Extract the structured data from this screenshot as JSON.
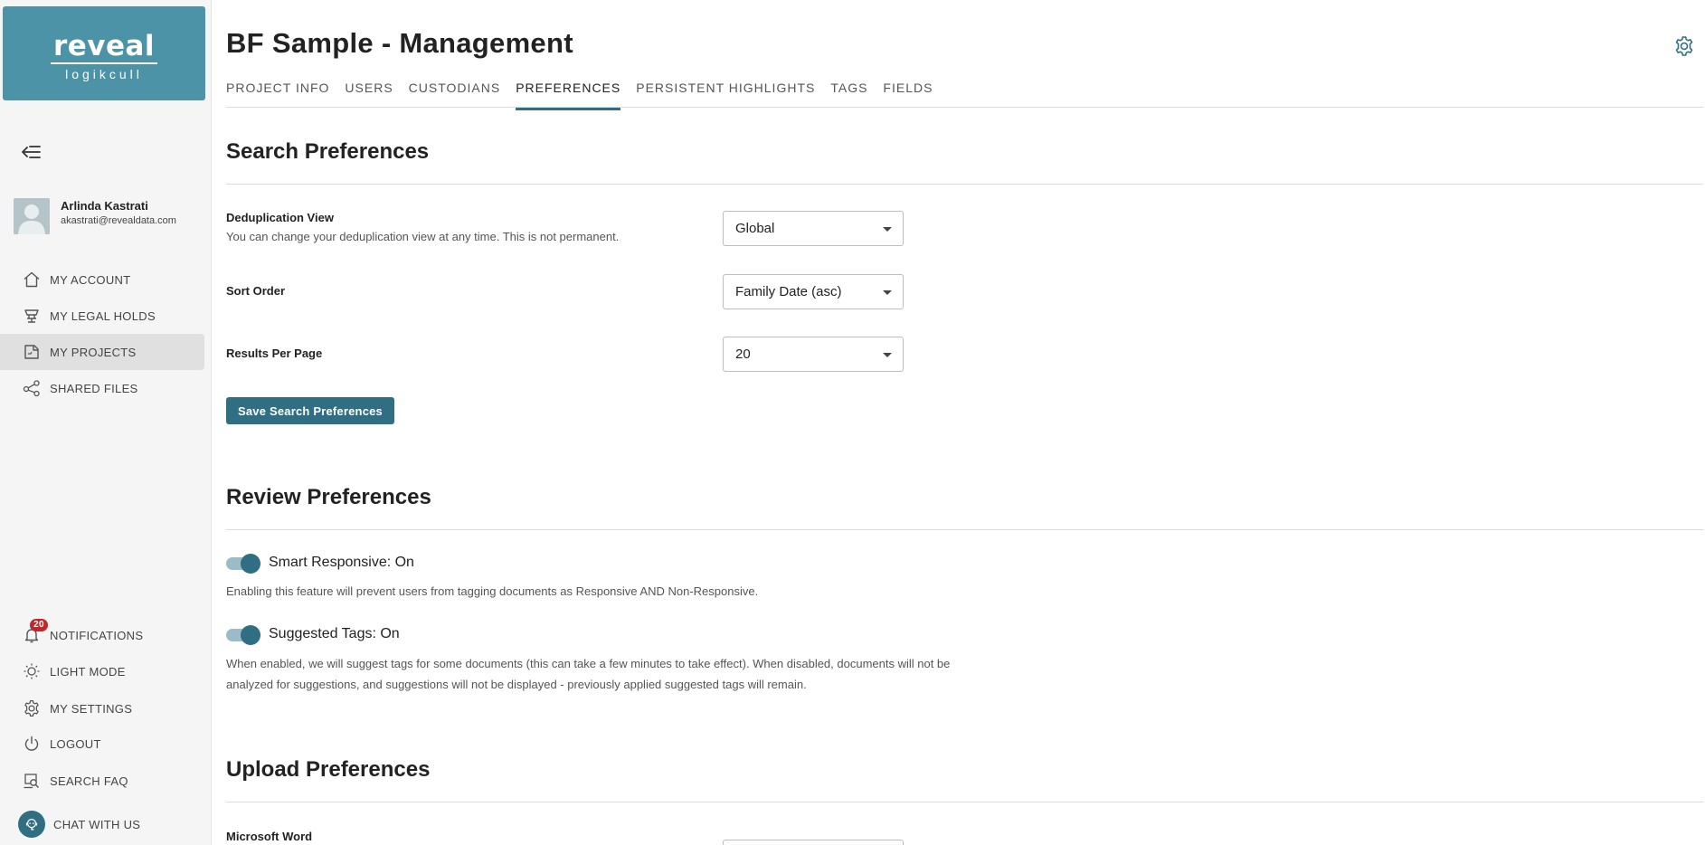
{
  "app": {
    "logo_brand": "reveal",
    "logo_sub": "logikcull"
  },
  "user": {
    "name": "Arlinda Kastrati",
    "email": "akastrati@revealdata.com"
  },
  "sidebar": {
    "items": [
      {
        "label": "MY ACCOUNT",
        "icon": "home-icon"
      },
      {
        "label": "MY LEGAL HOLDS",
        "icon": "legal-hold-icon"
      },
      {
        "label": "MY PROJECTS",
        "icon": "projects-icon",
        "active": true
      },
      {
        "label": "SHARED FILES",
        "icon": "share-icon"
      }
    ],
    "bottom_items": [
      {
        "label": "NOTIFICATIONS",
        "icon": "bell-icon",
        "badge": "20"
      },
      {
        "label": "LIGHT MODE",
        "icon": "sun-icon"
      },
      {
        "label": "MY SETTINGS",
        "icon": "gear-icon"
      },
      {
        "label": "LOGOUT",
        "icon": "power-icon"
      },
      {
        "label": "SEARCH FAQ",
        "icon": "faq-icon"
      },
      {
        "label": "CHAT WITH US",
        "icon": "chat-icon"
      }
    ]
  },
  "header": {
    "title": "BF Sample - Management"
  },
  "tabs": [
    {
      "label": "PROJECT INFO"
    },
    {
      "label": "USERS"
    },
    {
      "label": "CUSTODIANS"
    },
    {
      "label": "PREFERENCES",
      "active": true
    },
    {
      "label": "PERSISTENT HIGHLIGHTS"
    },
    {
      "label": "TAGS"
    },
    {
      "label": "FIELDS"
    }
  ],
  "search_prefs": {
    "title": "Search Preferences",
    "dedup_label": "Deduplication View",
    "dedup_help": "You can change your deduplication view at any time. This is not permanent.",
    "dedup_value": "Global",
    "sort_label": "Sort Order",
    "sort_value": "Family Date (asc)",
    "results_label": "Results Per Page",
    "results_value": "20",
    "save_label": "Save Search Preferences"
  },
  "review_prefs": {
    "title": "Review Preferences",
    "smart_label": "Smart Responsive: On",
    "smart_desc": "Enabling this feature will prevent users from tagging documents as Responsive AND Non-Responsive.",
    "suggested_label": "Suggested Tags: On",
    "suggested_desc": "When enabled, we will suggest tags for some documents (this can take a few minutes to take effect). When disabled, documents will not be analyzed for suggestions, and suggestions will not be displayed - previously applied suggested tags will remain."
  },
  "upload_prefs": {
    "title": "Upload Preferences",
    "word_label": "Microsoft Word"
  },
  "colors": {
    "accent": "#2f6e83",
    "logo_bg": "#4d93a8",
    "badge": "#c0272d"
  }
}
